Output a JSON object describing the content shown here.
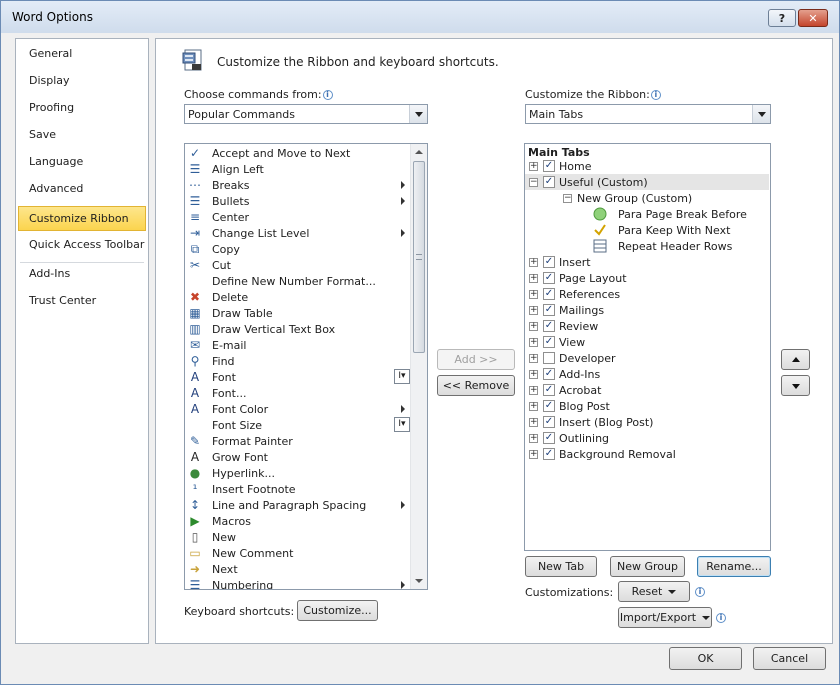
{
  "window": {
    "title": "Word Options",
    "help_label": "?",
    "close_label": "✕"
  },
  "nav": {
    "items": [
      {
        "label": "General"
      },
      {
        "label": "Display"
      },
      {
        "label": "Proofing"
      },
      {
        "label": "Save"
      },
      {
        "label": "Language"
      },
      {
        "label": "Advanced"
      },
      {
        "label": "Customize Ribbon",
        "selected": true
      },
      {
        "label": "Quick Access Toolbar"
      },
      {
        "label": "Add-Ins"
      },
      {
        "label": "Trust Center"
      }
    ]
  },
  "header": {
    "text": "Customize the Ribbon and keyboard shortcuts."
  },
  "left": {
    "choose_label": "Choose commands from:",
    "choose_value": "Popular Commands",
    "commands": [
      {
        "label": "Accept and Move to Next",
        "icon": "accept-icon"
      },
      {
        "label": "Align Left",
        "icon": "align-left-icon"
      },
      {
        "label": "Breaks",
        "icon": "breaks-icon",
        "submenu": true
      },
      {
        "label": "Bullets",
        "icon": "bullets-icon",
        "submenu": true
      },
      {
        "label": "Center",
        "icon": "center-icon"
      },
      {
        "label": "Change List Level",
        "icon": "list-level-icon",
        "submenu": true
      },
      {
        "label": "Copy",
        "icon": "copy-icon"
      },
      {
        "label": "Cut",
        "icon": "cut-icon"
      },
      {
        "label": "Define New Number Format...",
        "icon": ""
      },
      {
        "label": "Delete",
        "icon": "delete-icon"
      },
      {
        "label": "Draw Table",
        "icon": "draw-table-icon"
      },
      {
        "label": "Draw Vertical Text Box",
        "icon": "text-box-icon"
      },
      {
        "label": "E-mail",
        "icon": "email-icon"
      },
      {
        "label": "Find",
        "icon": "find-icon"
      },
      {
        "label": "Font",
        "icon": "font-icon",
        "combo": true
      },
      {
        "label": "Font...",
        "icon": "font-dialog-icon"
      },
      {
        "label": "Font Color",
        "icon": "font-color-icon",
        "submenu": true
      },
      {
        "label": "Font Size",
        "icon": "",
        "combo": true
      },
      {
        "label": "Format Painter",
        "icon": "format-painter-icon"
      },
      {
        "label": "Grow Font",
        "icon": "grow-font-icon"
      },
      {
        "label": "Hyperlink...",
        "icon": "hyperlink-icon"
      },
      {
        "label": "Insert Footnote",
        "icon": "footnote-icon"
      },
      {
        "label": "Line and Paragraph Spacing",
        "icon": "spacing-icon",
        "submenu": true
      },
      {
        "label": "Macros",
        "icon": "macros-icon"
      },
      {
        "label": "New",
        "icon": "new-icon"
      },
      {
        "label": "New Comment",
        "icon": "comment-icon"
      },
      {
        "label": "Next",
        "icon": "next-icon"
      },
      {
        "label": "Numbering",
        "icon": "numbering-icon",
        "submenu": true
      }
    ],
    "keyboard_label": "Keyboard shortcuts:",
    "customize_button": "Customize..."
  },
  "middle": {
    "add_button": "Add >>",
    "remove_button": "<< Remove"
  },
  "right": {
    "customize_label": "Customize the Ribbon:",
    "customize_value": "Main Tabs",
    "tree_header": "Main Tabs",
    "tree": [
      {
        "label": "Home",
        "level": 0,
        "expander": "+",
        "checked": true
      },
      {
        "label": "Useful (Custom)",
        "level": 0,
        "expander": "−",
        "checked": true,
        "selected": true
      },
      {
        "label": "New Group (Custom)",
        "level": 1,
        "expander": "−"
      },
      {
        "label": "Para Page Break Before",
        "level": 2,
        "icon": "green-circle-icon"
      },
      {
        "label": "Para Keep With Next",
        "level": 2,
        "icon": "checkmark-icon"
      },
      {
        "label": "Repeat Header Rows",
        "level": 2,
        "icon": "table-rows-icon"
      },
      {
        "label": "Insert",
        "level": 0,
        "expander": "+",
        "checked": true
      },
      {
        "label": "Page Layout",
        "level": 0,
        "expander": "+",
        "checked": true
      },
      {
        "label": "References",
        "level": 0,
        "expander": "+",
        "checked": true
      },
      {
        "label": "Mailings",
        "level": 0,
        "expander": "+",
        "checked": true
      },
      {
        "label": "Review",
        "level": 0,
        "expander": "+",
        "checked": true
      },
      {
        "label": "View",
        "level": 0,
        "expander": "+",
        "checked": true
      },
      {
        "label": "Developer",
        "level": 0,
        "expander": "+",
        "checked": false
      },
      {
        "label": "Add-Ins",
        "level": 0,
        "expander": "+",
        "checked": true
      },
      {
        "label": "Acrobat",
        "level": 0,
        "expander": "+",
        "checked": true
      },
      {
        "label": "Blog Post",
        "level": 0,
        "expander": "+",
        "checked": true
      },
      {
        "label": "Insert (Blog Post)",
        "level": 0,
        "expander": "+",
        "checked": true
      },
      {
        "label": "Outlining",
        "level": 0,
        "expander": "+",
        "checked": true
      },
      {
        "label": "Background Removal",
        "level": 0,
        "expander": "+",
        "checked": true
      }
    ],
    "new_tab_button": "New Tab",
    "new_group_button": "New Group",
    "rename_button": "Rename...",
    "customizations_label": "Customizations:",
    "reset_button": "Reset",
    "import_export_button": "Import/Export"
  },
  "footer": {
    "ok_button": "OK",
    "cancel_button": "Cancel"
  }
}
